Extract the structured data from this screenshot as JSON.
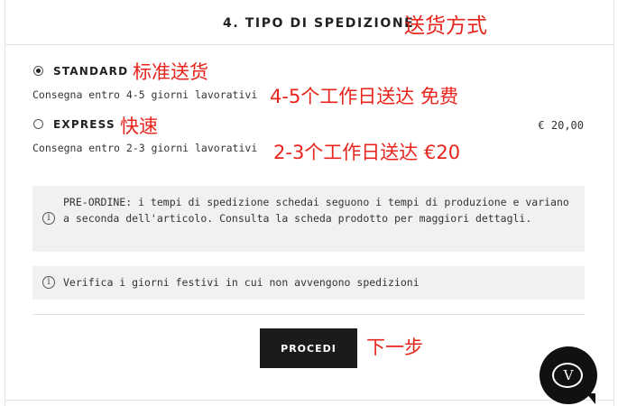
{
  "header": {
    "title": "4. TIPO DI SPEDIZIONE",
    "annotation": "送货方式"
  },
  "shipping": {
    "options": [
      {
        "label": "STANDARD",
        "selected": true,
        "description": "Consegna entro 4-5 giorni lavorativi",
        "label_annotation": "标准送货",
        "description_annotation": "4-5个工作日送达  免费"
      },
      {
        "label": "EXPRESS",
        "selected": false,
        "description": "Consegna entro 2-3 giorni lavorativi",
        "price": "€ 20,00",
        "label_annotation": "快速",
        "description_annotation": "2-3个工作日送达  €20"
      }
    ]
  },
  "notices": {
    "preorder": "PRE-ORDINE: i tempi di spedizione schedai seguono i tempi di produzione e variano a seconda dell'articolo. Consulta la scheda prodotto per maggiori dettagli.",
    "holidays": "Verifica i giorni festivi in cui non avvengono spedizioni"
  },
  "actions": {
    "proceed_label": "PROCEDI",
    "proceed_annotation": "下一步"
  },
  "chat": {
    "logo_text": "V"
  },
  "icons": {
    "info": "info-circle-icon"
  },
  "colors": {
    "annotation": "#e8241c",
    "button_bg": "#1b1b1b",
    "notice_bg": "#f1f1f1"
  }
}
